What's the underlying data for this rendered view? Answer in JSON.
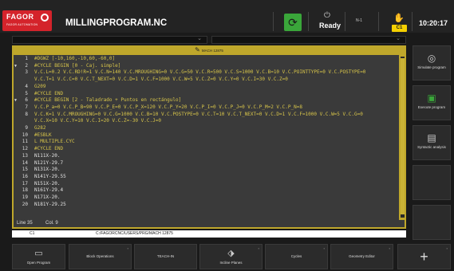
{
  "header": {
    "brand": "FAGOR",
    "brand_sub": "FAGOR AUTOMATION",
    "title": "MILLINGPROGRAM.NC",
    "status": "Ready",
    "channel_label": "N-1",
    "channel": "C1",
    "time": "10:20:17"
  },
  "editor": {
    "title": "MACH 12875",
    "lines": [
      {
        "n": "1",
        "t": "#DGWZ [-10,160,-10,60,-60,0]",
        "c": "dn"
      },
      {
        "n": "2",
        "t": "#CYCLE BEGIN [0 - Caj. simple]",
        "c": "dn",
        "fold": true
      },
      {
        "n": "3",
        "t": "V.C.L=0.2 V.C.RD!R=1 V.C.N=140 V.C.MROUGHING=0 V.C.G=50 V.C.R=500 V.C.S=1000 V.C.B=10 V.C.POINTTYPE=0 V.C.POSTYPE=0",
        "c": "dn"
      },
      {
        "n": "",
        "t": "V.C.T=1 V.C.C=0 V.C.T_NEXT=0 V.C.D=1 V.C.F=1000 V.C.W=5 V.C.Z=0 V.C.Y=0 V.C.I=30 V.C.Z=0",
        "c": "dn"
      },
      {
        "n": "4",
        "t": "G209",
        "c": "dn"
      },
      {
        "n": "5",
        "t": "#CYCLE END",
        "c": "dn"
      },
      {
        "n": "6",
        "t": "#CYCLE BEGIN [2 - Taladrado + Puntos en rectángulo]",
        "c": "dn",
        "fold": true
      },
      {
        "n": "7",
        "t": "V.C.P_a=0 V.C.P_B=90 V.C.P_E=0 V.C.P_X=120 V.C.P_Y=20 V.C.P_I=0 V.C.P_J=0 V.C.P_M=2 V.C.P_N=8",
        "c": "dn"
      },
      {
        "n": "8",
        "t": "V.C.K=1 V.C.MROUGHING=0 V.C.G=1000 V.C.B=10 V.C.POSTYPE=0 V.C.T=10 V.C.T_NEXT=0 V.C.D=1 V.C.F=1000 V.C.W=5 V.C.G=0",
        "c": "dn"
      },
      {
        "n": "",
        "t": "V.C.X=10 V.C.Y=10 V.C.I=20 V.C.Z=-30 V.C.J=0",
        "c": "dn"
      },
      {
        "n": "9",
        "t": "G282",
        "c": "dn"
      },
      {
        "n": "10",
        "t": "#ESBLK",
        "c": "dn"
      },
      {
        "n": "11",
        "t": "L MULTIPLE.CYC",
        "c": "dn"
      },
      {
        "n": "12",
        "t": "#CYCLE END",
        "c": "dn"
      },
      {
        "n": "13",
        "t": "N111X-20.",
        "c": "dm"
      },
      {
        "n": "14",
        "t": "N121Y-29.7",
        "c": "dm"
      },
      {
        "n": "15",
        "t": "N131X-20.",
        "c": "dm"
      },
      {
        "n": "16",
        "t": "N141Y-29.55",
        "c": "dm"
      },
      {
        "n": "17",
        "t": "N151X-20.",
        "c": "dm"
      },
      {
        "n": "18",
        "t": "N161Y-29.4",
        "c": "dm"
      },
      {
        "n": "19",
        "t": "N171X-20.",
        "c": "dm"
      },
      {
        "n": "20",
        "t": "N181Y-29.25",
        "c": "dm"
      }
    ],
    "status_line": "Line 35",
    "status_col": "Col. 9"
  },
  "pathbar": {
    "channel": "C1",
    "path": "C:/FAGORCNC/USERS/PRG/MACH 12875"
  },
  "right_buttons": [
    {
      "label": "Simulate program",
      "icon": "simulate-icon"
    },
    {
      "label": "Execute program",
      "icon": "execute-icon"
    },
    {
      "label": "Syntactic analysis",
      "icon": "syntax-icon"
    }
  ],
  "bottom_buttons": [
    {
      "label": "Open Program",
      "icon": "folder-icon"
    },
    {
      "label": "Block Operations",
      "icon": ""
    },
    {
      "label": "TEACH-IN",
      "icon": ""
    },
    {
      "label": "Incline Planes",
      "icon": "incline-planes-icon"
    },
    {
      "label": "Cycles",
      "icon": ""
    },
    {
      "label": "Geometry Editor",
      "icon": ""
    },
    {
      "label": "+",
      "icon": "plus-icon"
    }
  ],
  "colors": {
    "brand": "#d4232b",
    "editor_accent": "#bfa72b",
    "sync": "#3aa63a",
    "channel_badge": "#f5d000"
  }
}
